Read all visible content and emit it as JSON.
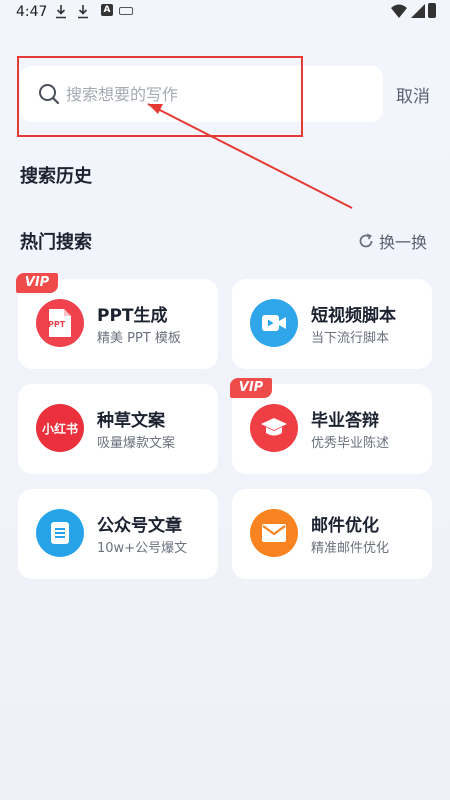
{
  "status_bar": {
    "time": "4:47"
  },
  "search": {
    "placeholder": "搜索想要的写作",
    "cancel_label": "取消"
  },
  "history": {
    "title": "搜索历史"
  },
  "hot": {
    "title": "热门搜索",
    "refresh_label": "换一换",
    "cards": [
      {
        "title": "PPT生成",
        "subtitle": "精美 PPT 模板",
        "vip": true,
        "icon_text": "PPT",
        "icon_color": "#f0424c"
      },
      {
        "title": "短视频脚本",
        "subtitle": "当下流行脚本",
        "vip": false,
        "icon_color": "#2fa6ea"
      },
      {
        "title": "种草文案",
        "subtitle": "吸量爆款文案",
        "vip": false,
        "icon_text": "小红书",
        "icon_color": "#ea2f3d"
      },
      {
        "title": "毕业答辩",
        "subtitle": "优秀毕业陈述",
        "vip": true,
        "icon_color": "#ef3f45"
      },
      {
        "title": "公众号文章",
        "subtitle": "10w+公号爆文",
        "vip": false,
        "icon_color": "#27a3ea"
      },
      {
        "title": "邮件优化",
        "subtitle": "精准邮件优化",
        "vip": false,
        "icon_color": "#f98320"
      }
    ],
    "vip_label": "VIP"
  },
  "colors": {
    "accent": "#e53935",
    "vip": "#f04b4b"
  }
}
